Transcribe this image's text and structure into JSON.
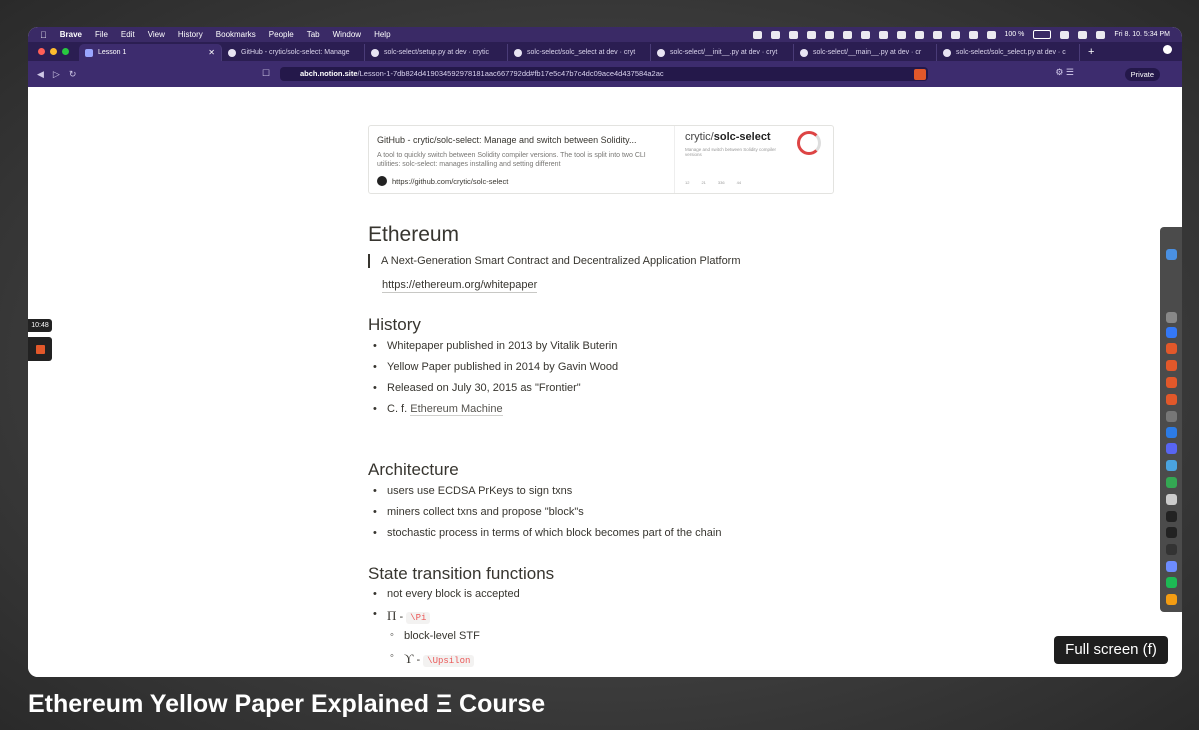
{
  "menubar": {
    "app": "Brave",
    "items": [
      "File",
      "Edit",
      "View",
      "History",
      "Bookmarks",
      "People",
      "Tab",
      "Window",
      "Help"
    ],
    "battery": "100 %",
    "datetime": "Fri 8. 10.  5:34 PM"
  },
  "tabs": [
    {
      "label": "Lesson 1",
      "active": true
    },
    {
      "label": "GitHub - crytic/solc-select: Manage"
    },
    {
      "label": "solc-select/setup.py at dev · crytic"
    },
    {
      "label": "solc-select/solc_select at dev · cryt"
    },
    {
      "label": "solc-select/__init__.py at dev · cryt"
    },
    {
      "label": "solc-select/__main__.py at dev · cr"
    },
    {
      "label": "solc-select/solc_select.py at dev · c"
    }
  ],
  "address": {
    "host": "abch.notion.site",
    "path": "/Lesson-1-7db824d419034592978181aac667792dd#fb17e5c47b7c4dc09ace4d437584a2ac",
    "private_label": "Private"
  },
  "bookmark": {
    "title": "GitHub - crytic/solc-select: Manage and switch between Solidity...",
    "description": "A tool to quickly switch between Solidity compiler versions. The tool is split into two CLI utilities: solc-select: manages installing and setting different",
    "url": "https://github.com/crytic/solc-select",
    "thumb_owner": "crytic/",
    "thumb_repo": "solc-select",
    "thumb_subtitle": "Manage and switch between Solidity compiler versions",
    "thumb_stats": [
      "12",
      "21",
      "336",
      "44"
    ]
  },
  "doc": {
    "title": "Ethereum",
    "quote": "A Next-Generation Smart Contract and Decentralized Application Platform",
    "link": "https://ethereum.org/whitepaper",
    "history_heading": "History",
    "history": [
      "Whitepaper published in 2013 by Vitalik Buterin",
      "Yellow Paper published in 2014 by Gavin Wood",
      "Released on July 30, 2015 as \"Frontier\""
    ],
    "history_cf_prefix": "C. f.",
    "history_cf_link": "Ethereum Machine",
    "architecture_heading": "Architecture",
    "architecture": [
      "users use ECDSA PrKeys to sign txns",
      "miners collect txns and propose \"block\"s",
      "stochastic process in terms of which block becomes part of the chain"
    ],
    "stf_heading": "State transition functions",
    "stf_first": "not every block is accepted",
    "pi_symbol": "Π",
    "pi_code": "\\Pi",
    "pi_sub": "block-level STF",
    "upsilon_symbol": "ϒ",
    "upsilon_code": "\\Upsilon"
  },
  "overlay": {
    "timer": "10:48",
    "fullscreen": "Full screen (f)"
  },
  "caption": "Ethereum Yellow Paper Explained Ξ Course"
}
